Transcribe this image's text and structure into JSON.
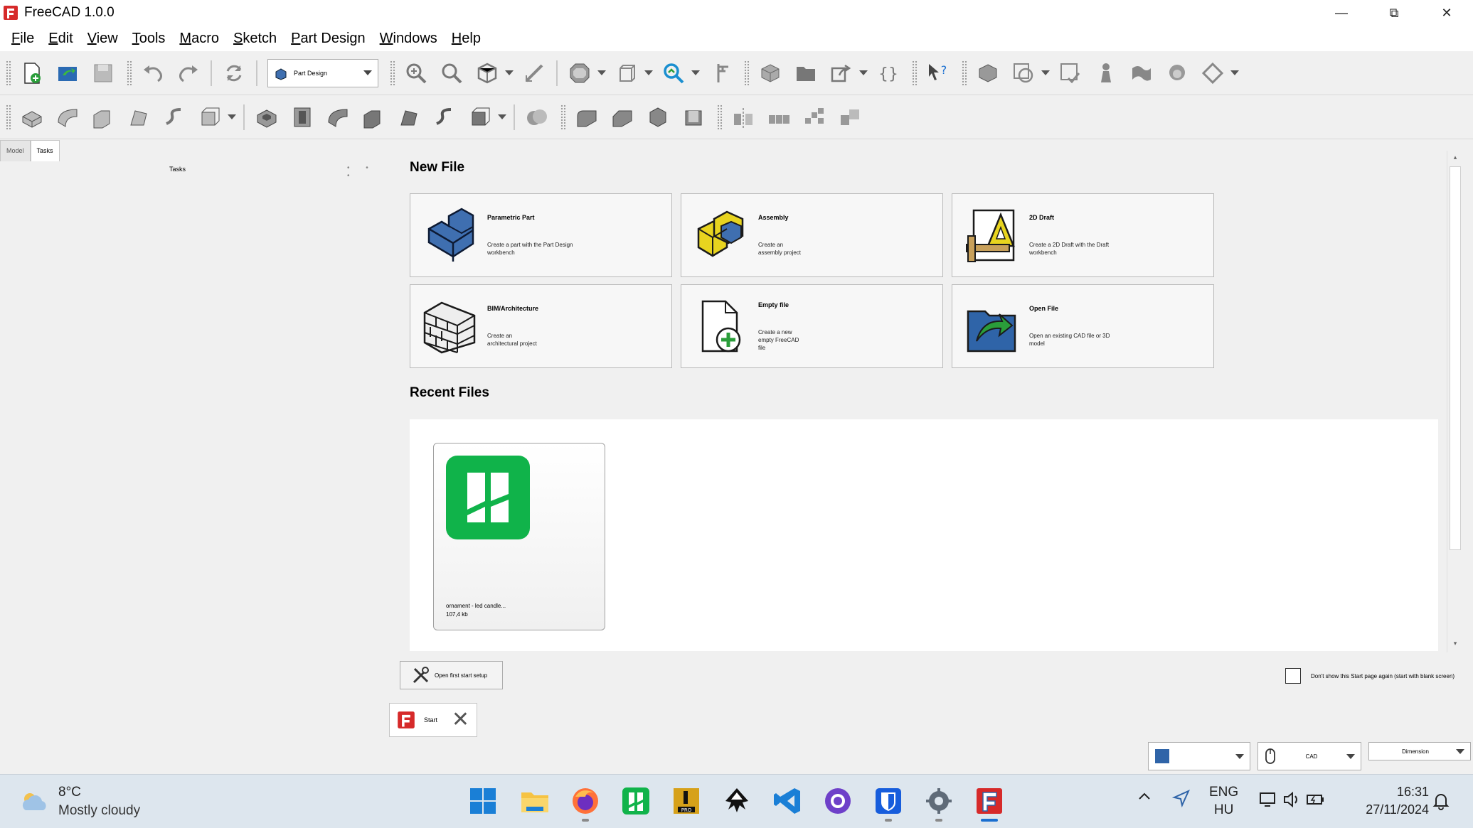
{
  "window": {
    "title": "FreeCAD 1.0.0",
    "min": "—",
    "max": "⧉",
    "close": "✕"
  },
  "menu": [
    {
      "first": "F",
      "rest": "ile"
    },
    {
      "first": "E",
      "rest": "dit"
    },
    {
      "first": "V",
      "rest": "iew"
    },
    {
      "first": "T",
      "rest": "ools"
    },
    {
      "first": "M",
      "rest": "acro"
    },
    {
      "first": "S",
      "rest": "ketch"
    },
    {
      "first": "P",
      "rest": "art Design"
    },
    {
      "first": "W",
      "rest": "indows"
    },
    {
      "first": "H",
      "rest": "elp"
    }
  ],
  "toolbar": {
    "workbench": "Part Design"
  },
  "left_panel": {
    "tabs": [
      "Model",
      "Tasks"
    ],
    "header": "Tasks",
    "dots": "• • •"
  },
  "start": {
    "new_file_title": "New File",
    "cards": [
      {
        "title": "Parametric Part",
        "desc": "Create a part with the Part Design\nworkbench",
        "icon": "parametric-part-icon"
      },
      {
        "title": "Assembly",
        "desc": "Create an\nassembly project",
        "icon": "assembly-icon"
      },
      {
        "title": "2D Draft",
        "desc": "Create a 2D Draft with the Draft\nworkbench",
        "icon": "draft-icon"
      },
      {
        "title": "BIM/Architecture",
        "desc": "Create an\narchitectural project",
        "icon": "bim-icon"
      },
      {
        "title": "Empty file",
        "desc": "Create a new\nempty FreeCAD\nfile",
        "icon": "empty-file-icon"
      },
      {
        "title": "Open File",
        "desc": "Open an existing CAD file or 3D\nmodel",
        "icon": "open-file-icon"
      }
    ],
    "recent_title": "Recent Files",
    "recent": [
      {
        "name": "ornament - led candle...",
        "size": "107,4 kb"
      }
    ],
    "first_start_label": "Open first start setup",
    "dont_show_label": "Don't show this Start page again (start with blank screen)"
  },
  "doc_tab": {
    "label": "Start",
    "close": "✕"
  },
  "status": {
    "nav_style": "CAD",
    "units": "Dimension"
  },
  "taskbar": {
    "weather_temp": "8°C",
    "weather_cond": "Mostly cloudy",
    "lang1": "ENG",
    "lang2": "HU",
    "time": "16:31",
    "date": "27/11/2024"
  },
  "colors": {
    "accent": "#1a6fd0",
    "freecad_red": "#d62a2a",
    "green": "#10b34a"
  }
}
